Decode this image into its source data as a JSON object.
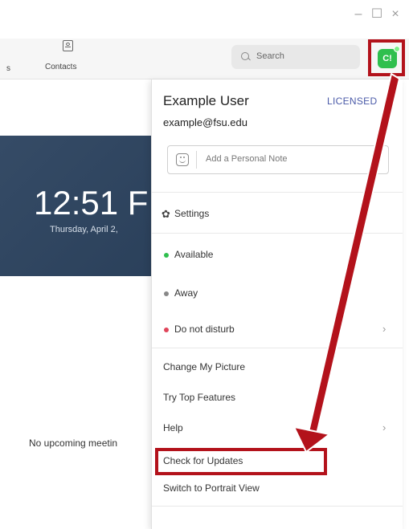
{
  "window": {
    "min_glyph": "–",
    "max_glyph": "☐",
    "close_glyph": "×"
  },
  "nav": {
    "cut_label": "s",
    "contacts_label": "Contacts",
    "search_placeholder": "Search",
    "avatar_initials": "C!"
  },
  "home": {
    "clock_time": "12:51 F",
    "clock_date": "Thursday, April 2,",
    "no_meetings": "No upcoming meetin"
  },
  "menu": {
    "user_name": "Example User",
    "license": "LICENSED",
    "email": "example@fsu.edu",
    "personal_note_placeholder": "Add a Personal Note",
    "items": {
      "settings": "Settings",
      "available": "Available",
      "away": "Away",
      "dnd": "Do not disturb",
      "change_picture": "Change My Picture",
      "top_features": "Try Top Features",
      "help": "Help",
      "check_updates": "Check for Updates",
      "portrait_view": "Switch to Portrait View"
    },
    "chevron": "›"
  },
  "colors": {
    "annotation_red": "#b3121b",
    "available_green": "#2fbf4e",
    "away_gray": "#888888",
    "dnd_red": "#e0455a",
    "license_blue": "#4a5aa8"
  }
}
